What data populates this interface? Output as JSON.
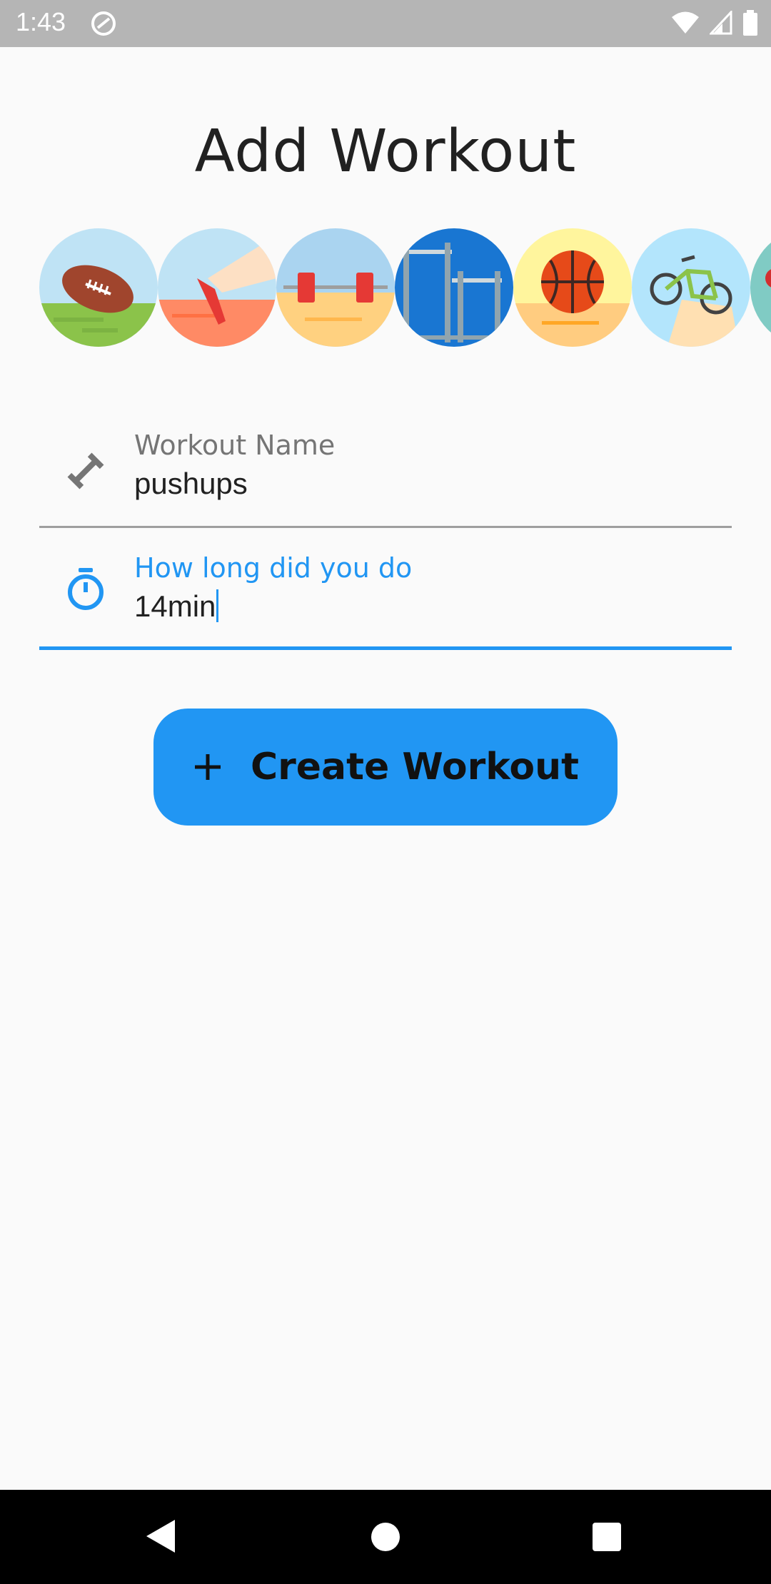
{
  "status_bar": {
    "time": "1:43",
    "icons": [
      "sync-icon",
      "wifi-icon",
      "signal-icon",
      "battery-icon"
    ]
  },
  "page": {
    "title": "Add Workout"
  },
  "activities": [
    {
      "name": "football",
      "selected": false
    },
    {
      "name": "running",
      "selected": false
    },
    {
      "name": "weightlifting",
      "selected": false
    },
    {
      "name": "parallel-bars",
      "selected": true
    },
    {
      "name": "basketball",
      "selected": false
    },
    {
      "name": "cycling",
      "selected": false
    },
    {
      "name": "more",
      "selected": false
    }
  ],
  "form": {
    "workout_name": {
      "label": "Workout Name",
      "value": "pushups",
      "icon": "dumbbell-icon"
    },
    "duration": {
      "label": "How long did you do",
      "value": "14min",
      "icon": "timer-icon",
      "focused": true
    },
    "submit": {
      "label": "Create Workout",
      "icon": "plus-icon"
    }
  },
  "colors": {
    "accent": "#2196f3",
    "background": "#fafafa",
    "status_bar": "#b5b5b5",
    "nav_bar": "#000000"
  },
  "nav_bar": {
    "buttons": [
      "back-icon",
      "home-icon",
      "recents-icon"
    ]
  }
}
